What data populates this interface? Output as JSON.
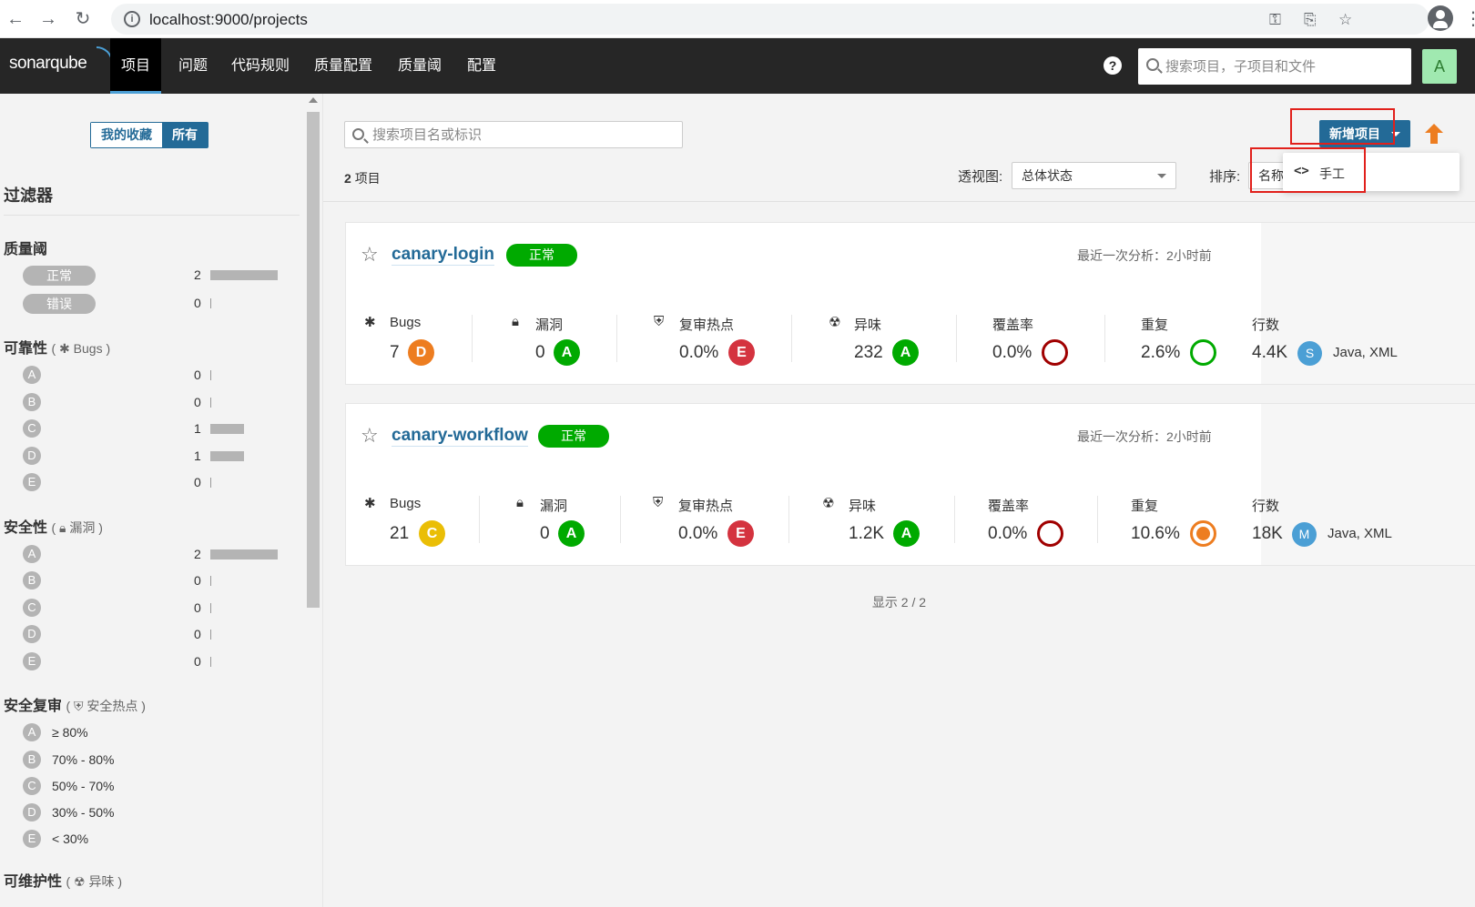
{
  "browser": {
    "url": "localhost:9000/projects",
    "back_icon": "arrow-left-icon",
    "forward_icon": "arrow-right-icon",
    "reload_icon": "reload-icon"
  },
  "header": {
    "logo": "sonarqube",
    "menu": [
      {
        "label": "项目",
        "active": true
      },
      {
        "label": "问题"
      },
      {
        "label": "代码规则"
      },
      {
        "label": "质量配置"
      },
      {
        "label": "质量阈"
      },
      {
        "label": "配置"
      }
    ],
    "search_placeholder": "搜索项目，子项目和文件",
    "avatar_letter": "A",
    "help_glyph": "?"
  },
  "sidebar": {
    "toggle": {
      "favorites": "我的收藏",
      "all": "所有"
    },
    "filters_title": "过滤器",
    "quality_gate": {
      "title": "质量阈",
      "items": [
        {
          "label": "正常",
          "count": "2",
          "fraction": 1.0
        },
        {
          "label": "错误",
          "count": "0",
          "fraction": 0
        }
      ]
    },
    "reliability": {
      "title": "可靠性",
      "sub": "Bugs",
      "items": [
        {
          "grade": "A",
          "count": "0",
          "fraction": 0
        },
        {
          "grade": "B",
          "count": "0",
          "fraction": 0
        },
        {
          "grade": "C",
          "count": "1",
          "fraction": 0.5
        },
        {
          "grade": "D",
          "count": "1",
          "fraction": 0.5
        },
        {
          "grade": "E",
          "count": "0",
          "fraction": 0
        }
      ]
    },
    "security": {
      "title": "安全性",
      "sub": "漏洞",
      "items": [
        {
          "grade": "A",
          "count": "2",
          "fraction": 1.0
        },
        {
          "grade": "B",
          "count": "0",
          "fraction": 0
        },
        {
          "grade": "C",
          "count": "0",
          "fraction": 0
        },
        {
          "grade": "D",
          "count": "0",
          "fraction": 0
        },
        {
          "grade": "E",
          "count": "0",
          "fraction": 0
        }
      ]
    },
    "security_review": {
      "title": "安全复审",
      "sub": "安全热点",
      "items": [
        {
          "grade": "A",
          "range": "≥ 80%"
        },
        {
          "grade": "B",
          "range": "70% - 80%"
        },
        {
          "grade": "C",
          "range": "50% - 70%"
        },
        {
          "grade": "D",
          "range": "30% - 50%"
        },
        {
          "grade": "E",
          "range": "< 30%"
        }
      ]
    },
    "maintainability": {
      "title": "可维护性",
      "sub": "异味"
    }
  },
  "main": {
    "search_placeholder": "搜索项目名或标识",
    "new_project_label": "新增项目",
    "dropdown_item": "手工",
    "count_number": "2",
    "count_suffix": "项目",
    "perspective_label": "透视图:",
    "perspective_value": "总体状态",
    "sort_label": "排序:",
    "sort_value": "名称",
    "pager": "显示 2 / 2"
  },
  "projects": [
    {
      "name": "canary-login",
      "quality_gate": "正常",
      "last_analysis": "最近一次分析：2小时前",
      "bugs_label": "Bugs",
      "bugs": "7",
      "bugs_rating": "D",
      "vuln_label": "漏洞",
      "vulns": "0",
      "vuln_rating": "A",
      "hotspots_label": "复审热点",
      "hotspots": "0.0%",
      "hotspot_rating": "E",
      "smells_label": "异味",
      "smells": "232",
      "smell_rating": "A",
      "coverage_label": "覆盖率",
      "coverage": "0.0%",
      "dup_label": "重复",
      "duplications": "2.6%",
      "lines_label": "行数",
      "lines": "4.4K",
      "size": "S",
      "languages": "Java, XML"
    },
    {
      "name": "canary-workflow",
      "quality_gate": "正常",
      "last_analysis": "最近一次分析：2小时前",
      "bugs_label": "Bugs",
      "bugs": "21",
      "bugs_rating": "C",
      "vuln_label": "漏洞",
      "vulns": "0",
      "vuln_rating": "A",
      "hotspots_label": "复审热点",
      "hotspots": "0.0%",
      "hotspot_rating": "E",
      "smells_label": "异味",
      "smells": "1.2K",
      "smell_rating": "A",
      "coverage_label": "覆盖率",
      "coverage": "0.0%",
      "dup_label": "重复",
      "duplications": "10.6%",
      "lines_label": "行数",
      "lines": "18K",
      "size": "M",
      "languages": "Java, XML"
    }
  ],
  "colors": {
    "header_bg": "#262626",
    "accent": "#236a97",
    "rating_A": "#00aa00",
    "rating_C": "#eabe06",
    "rating_D": "#ed7d20",
    "rating_E": "#d4333f",
    "coverage_ring": "#a00000",
    "dup_ring_low": "#00aa00",
    "dup_ring_high": "#ed7d20",
    "annotation_red": "#e1201b"
  }
}
